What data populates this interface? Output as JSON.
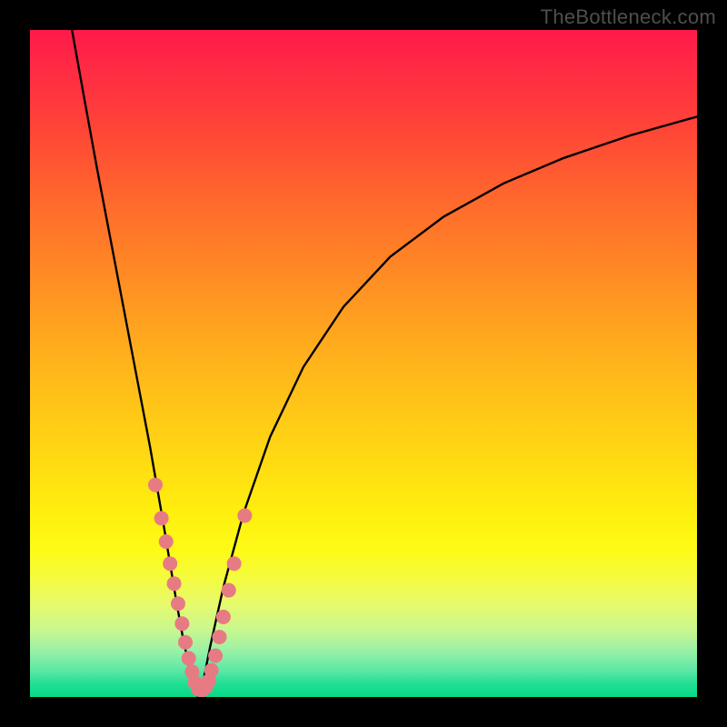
{
  "watermark": "TheBottleneck.com",
  "chart_data": {
    "type": "line",
    "title": "",
    "xlabel": "",
    "ylabel": "",
    "xlim": [
      0,
      1
    ],
    "ylim": [
      0,
      1
    ],
    "series": [
      {
        "name": "left-curve",
        "x": [
          0.063,
          0.08,
          0.1,
          0.12,
          0.14,
          0.16,
          0.18,
          0.2,
          0.21,
          0.22,
          0.23,
          0.24,
          0.252
        ],
        "y": [
          1.0,
          0.905,
          0.795,
          0.69,
          0.585,
          0.48,
          0.375,
          0.26,
          0.2,
          0.14,
          0.085,
          0.04,
          0.0
        ]
      },
      {
        "name": "right-curve",
        "x": [
          0.255,
          0.27,
          0.29,
          0.32,
          0.36,
          0.41,
          0.47,
          0.54,
          0.62,
          0.71,
          0.8,
          0.9,
          1.0
        ],
        "y": [
          0.0,
          0.075,
          0.165,
          0.275,
          0.39,
          0.495,
          0.585,
          0.66,
          0.72,
          0.77,
          0.808,
          0.842,
          0.87
        ]
      }
    ],
    "scatter": {
      "name": "pink-dots",
      "x": [
        0.188,
        0.197,
        0.204,
        0.21,
        0.216,
        0.222,
        0.228,
        0.233,
        0.238,
        0.243,
        0.247,
        0.252,
        0.257,
        0.263,
        0.268,
        0.272,
        0.278,
        0.284,
        0.29,
        0.298,
        0.306,
        0.322
      ],
      "y": [
        0.318,
        0.268,
        0.233,
        0.2,
        0.17,
        0.14,
        0.11,
        0.082,
        0.058,
        0.038,
        0.022,
        0.012,
        0.01,
        0.014,
        0.024,
        0.04,
        0.062,
        0.09,
        0.12,
        0.16,
        0.2,
        0.272
      ]
    },
    "gradient_stops": [
      {
        "pos": 0.0,
        "color": "#ff1a4a"
      },
      {
        "pos": 0.5,
        "color": "#ffb41b"
      },
      {
        "pos": 0.78,
        "color": "#fdfb16"
      },
      {
        "pos": 1.0,
        "color": "#06da87"
      }
    ]
  }
}
